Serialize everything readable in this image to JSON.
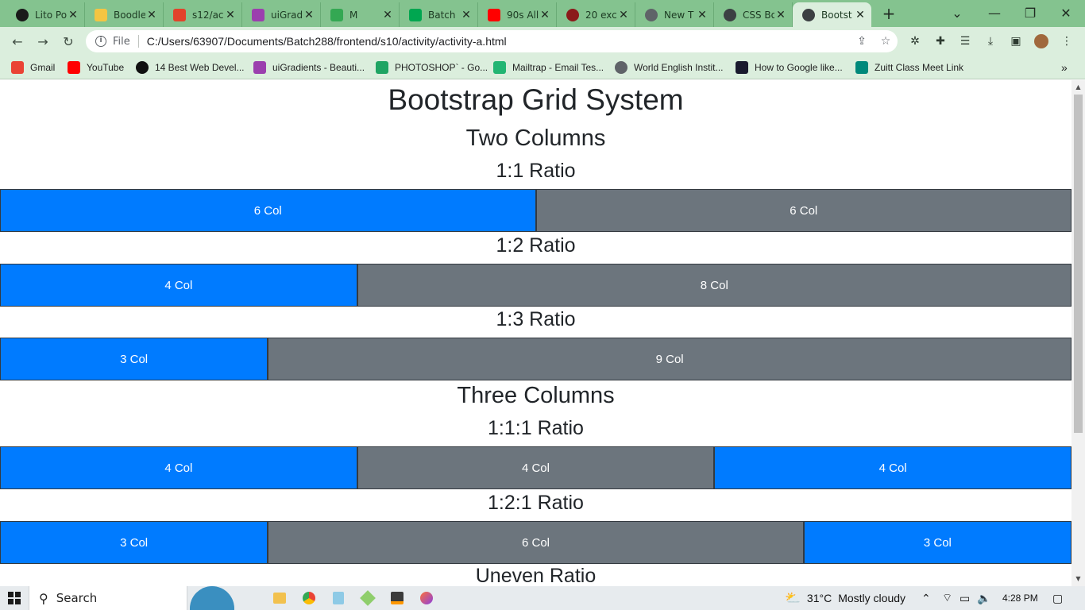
{
  "browser": {
    "tabs": [
      {
        "title": "Lito Po",
        "color": "#1a1a1a",
        "active": false
      },
      {
        "title": "Boodle",
        "color": "#f4c542",
        "active": false
      },
      {
        "title": "s12/ac",
        "color": "#e2432a",
        "active": false
      },
      {
        "title": "uiGrad",
        "color": "#9b3fae",
        "active": false
      },
      {
        "title": "M",
        "color": "#34a853",
        "active": false
      },
      {
        "title": "Batch",
        "color": "#00a650",
        "active": false
      },
      {
        "title": "90s All",
        "color": "#ff0000",
        "active": false
      },
      {
        "title": "20 exc",
        "color": "#8b1a1a",
        "active": false
      },
      {
        "title": "New T",
        "color": "#5f6368",
        "active": false
      },
      {
        "title": "CSS Bo",
        "color": "#3c4043",
        "active": false
      },
      {
        "title": "Bootst",
        "color": "#3c4043",
        "active": true
      }
    ],
    "new_tab_label": "+",
    "address": {
      "scheme_label": "File",
      "url": "C:/Users/63907/Documents/Batch288/frontend/s10/activity/activity-a.html"
    },
    "bookmarks": [
      {
        "label": "Gmail",
        "color": "#ea4335"
      },
      {
        "label": "YouTube",
        "color": "#ff0000"
      },
      {
        "label": "14 Best Web Devel...",
        "color": "#111111"
      },
      {
        "label": "uiGradients - Beauti...",
        "color": "#9b3fae"
      },
      {
        "label": "PHOTOSHOP` - Go...",
        "color": "#1fa463"
      },
      {
        "label": "Mailtrap - Email Tes...",
        "color": "#22b573"
      },
      {
        "label": "World English Instit...",
        "color": "#5f6368"
      },
      {
        "label": "How to Google like...",
        "color": "#1a1a2e"
      },
      {
        "label": "Zuitt Class Meet Link",
        "color": "#00897b"
      }
    ],
    "bookmarks_overflow": "»"
  },
  "page": {
    "title": "Bootstrap Grid System",
    "sections": {
      "two_columns": "Two Columns",
      "three_columns": "Three Columns",
      "uneven": "Uneven Ratio"
    },
    "ratios": {
      "r11": "1:1 Ratio",
      "r12": "1:2 Ratio",
      "r13": "1:3 Ratio",
      "r111": "1:1:1 Ratio",
      "r121": "1:2:1 Ratio"
    },
    "rows": {
      "r11": [
        "6 Col",
        "6 Col"
      ],
      "r12": [
        "4 Col",
        "8 Col"
      ],
      "r13": [
        "3 Col",
        "9 Col"
      ],
      "r111": [
        "4 Col",
        "4 Col",
        "4 Col"
      ],
      "r121": [
        "3 Col",
        "6 Col",
        "3 Col"
      ]
    },
    "colors": {
      "primary": "#007bff",
      "secondary": "#6c757d"
    }
  },
  "taskbar": {
    "search_label": "Search",
    "weather_temp": "31°C",
    "weather_text": "Mostly cloudy",
    "time": "4:28 PM"
  }
}
